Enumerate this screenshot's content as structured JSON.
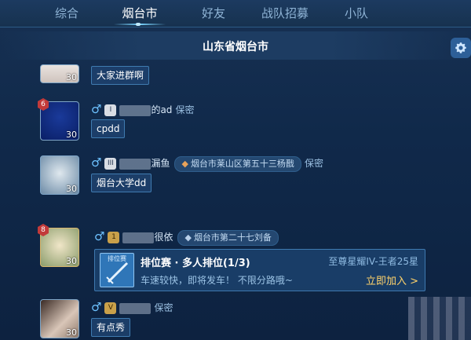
{
  "tabs": [
    {
      "label": "综合",
      "active": false
    },
    {
      "label": "烟台市",
      "active": true
    },
    {
      "label": "好友",
      "active": false
    },
    {
      "label": "战队招募",
      "active": false
    },
    {
      "label": "小队",
      "active": false
    }
  ],
  "header": {
    "title": "山东省烟台市"
  },
  "messages": [
    {
      "level": "30",
      "bubble": "大家进群啊"
    },
    {
      "level": "30",
      "rank": "6",
      "gender": "♂",
      "badge": "I",
      "name_suffix": "的ad",
      "privacy": "保密",
      "bubble": "cpdd"
    },
    {
      "level": "30",
      "gender": "♂",
      "badge": "III",
      "name_suffix": "漏鱼",
      "location": "烟台市莱山区第五十三杨戬",
      "privacy": "保密",
      "bubble": "烟台大学dd"
    },
    {
      "level": "30",
      "rank": "8",
      "gender": "♂",
      "badge": "1",
      "name_suffix": "很依",
      "location": "烟台市第二十七刘备"
    },
    {
      "level": "30",
      "gender": "♂",
      "badge": "V",
      "privacy": "保密",
      "bubble": "有点秀"
    }
  ],
  "invite": {
    "icon_label": "排位赛",
    "title": "排位赛 · 多人排位(1/3)",
    "range": "至尊星耀IV-王者25星",
    "desc": "车速较快，即将发车！ 不限分路哦~",
    "join": "立即加入 >"
  },
  "colors": {
    "accent": "#7ad4ff",
    "join": "#ffd36b",
    "background": "#10294a"
  }
}
